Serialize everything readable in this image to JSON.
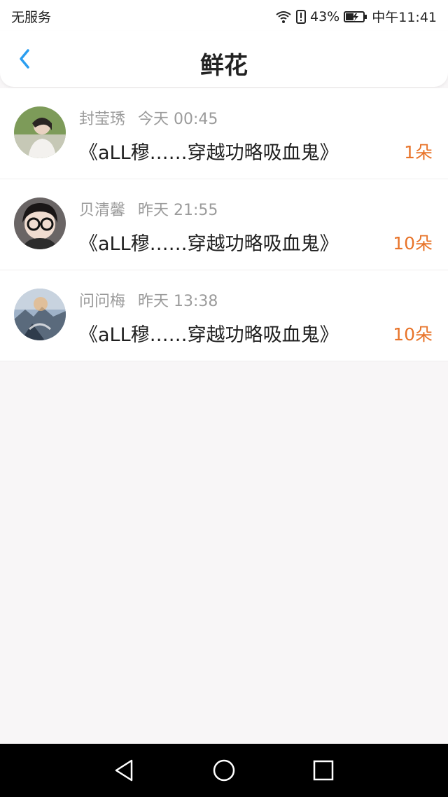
{
  "status_bar": {
    "carrier": "无服务",
    "battery_percent": "43%",
    "time": "中午11:41",
    "icons": [
      "wifi-icon",
      "alert-icon",
      "battery-charging-icon"
    ]
  },
  "header": {
    "title": "鲜花",
    "back_icon": "chevron-left-icon",
    "accent_color": "#2b9ef0"
  },
  "items": [
    {
      "name": "封莹琇",
      "time": "今天 00:45",
      "book": "《aLL穆……穿越功略吸血鬼》",
      "count": "1朵"
    },
    {
      "name": "贝清馨",
      "time": "昨天 21:55",
      "book": "《aLL穆……穿越功略吸血鬼》",
      "count": "10朵"
    },
    {
      "name": "问问梅",
      "time": "昨天 13:38",
      "book": "《aLL穆……穿越功略吸血鬼》",
      "count": "10朵"
    }
  ],
  "colors": {
    "count": "#e8742a",
    "meta": "#9b9b9b",
    "background": "#f8f6f7"
  },
  "nav_bar": {
    "icons": [
      "back-triangle-icon",
      "home-circle-icon",
      "recents-square-icon"
    ]
  }
}
